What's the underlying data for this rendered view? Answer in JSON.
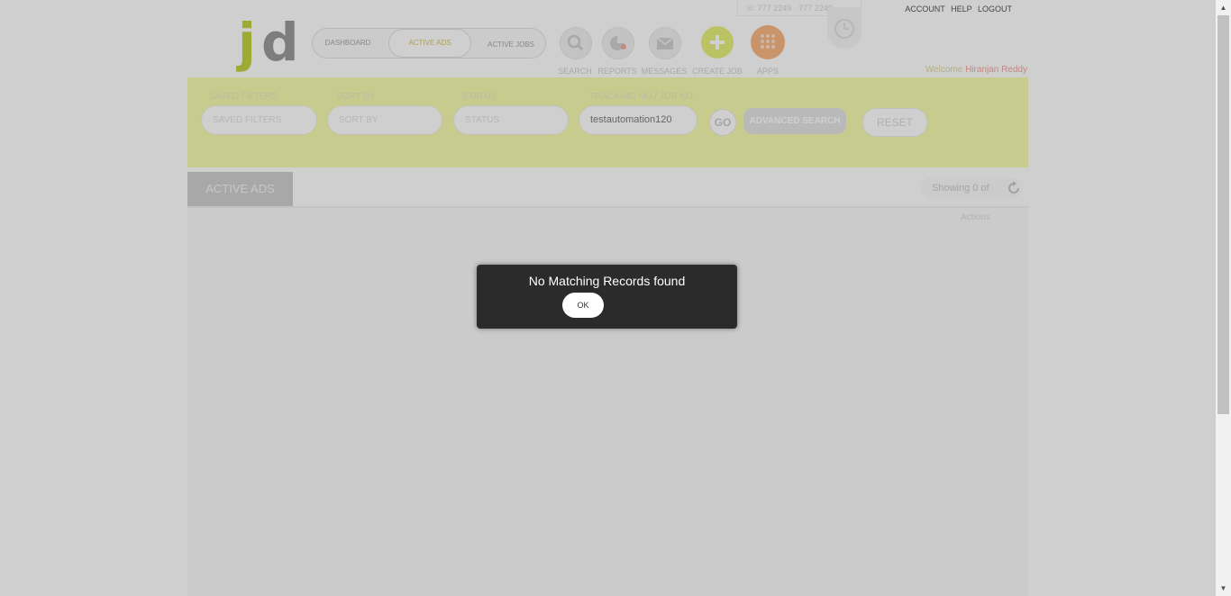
{
  "header": {
    "logo_j": "j",
    "logo_d": "d",
    "nav_tabs": [
      "DASHBOARD",
      "ACTIVE ADS",
      "ACTIVE JOBS"
    ],
    "icons": [
      {
        "name": "search-icon",
        "label": "SEARCH"
      },
      {
        "name": "reports-icon",
        "label": "REPORTS"
      },
      {
        "name": "messages-icon",
        "label": "MESSAGES"
      },
      {
        "name": "create-job-icon",
        "label": "CREATE JOB"
      },
      {
        "name": "apps-icon",
        "label": "APPS"
      }
    ],
    "phone": "☏ 777 2249 · 777 2249",
    "top_links": [
      "ACCOUNT",
      "HELP",
      "LOGOUT"
    ],
    "welcome_prefix": "Welcome",
    "welcome_user": "Hiranjan Reddy"
  },
  "filters": {
    "saved_filters_label": "SAVED FILTERS",
    "saved_filters_placeholder": "SAVED FILTERS",
    "sort_by_label": "SORT BY",
    "sort_by_placeholder": "SORT BY",
    "status_label": "STATUS",
    "status_placeholder": "STATUS",
    "tracking_label": "TRACKING NO / JOB NO",
    "tracking_value": "testautomation120",
    "go_label": "GO",
    "advanced_search_label": "ADVANCED SEARCH",
    "reset_label": "RESET"
  },
  "listing": {
    "active_tab": "ACTIVE ADS",
    "showing": "Showing 0 of",
    "actions_header": "Actions"
  },
  "dialog": {
    "message": "No Matching Records found",
    "ok_label": "OK"
  },
  "colors": {
    "brand_lime": "#c2d23f",
    "filter_band": "#f6faaf",
    "apps_orange": "#f9b784",
    "dialog_bg": "#2b2b2b"
  }
}
